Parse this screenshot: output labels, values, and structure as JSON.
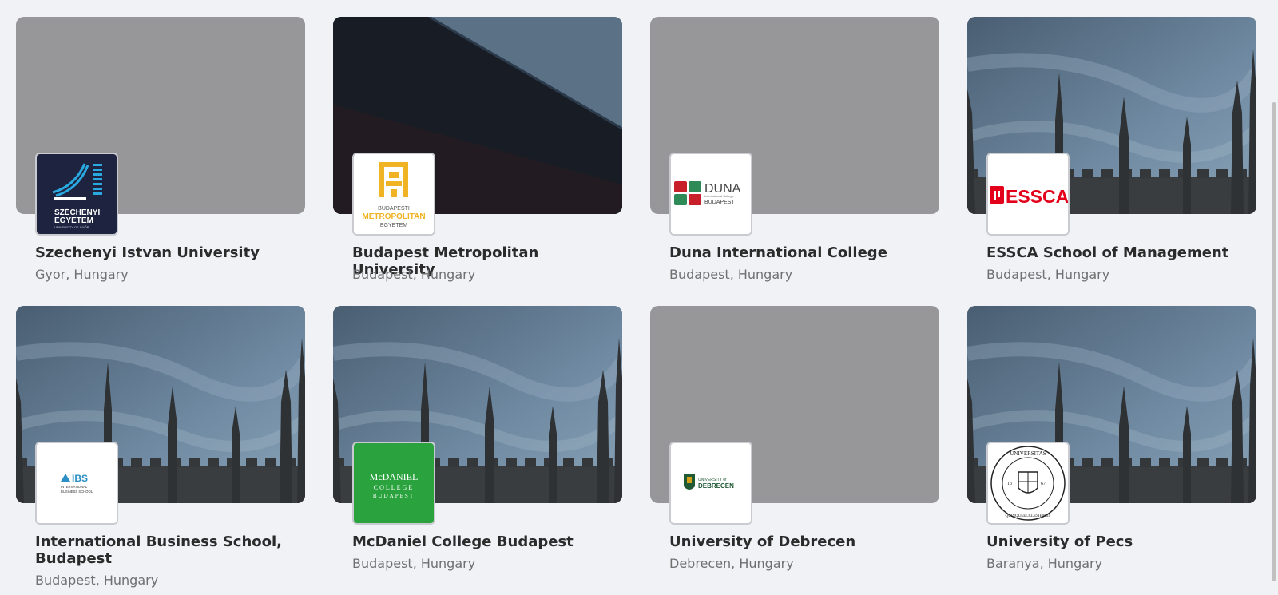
{
  "universities": [
    {
      "name": "Szechenyi Istvan University",
      "location": "Gyor, Hungary",
      "logo_text": [
        "SZÉCHENYI",
        "EGYETEM",
        "UNIVERSITY OF GYŐR"
      ]
    },
    {
      "name": "Budapest Metropolitan University",
      "location": "Budapest, Hungary",
      "logo_text": [
        "BUDAPESTI",
        "METROPOLITAN",
        "EGYETEM"
      ]
    },
    {
      "name": "Duna International College",
      "location": "Budapest, Hungary",
      "logo_text": [
        "DUNA",
        "International College",
        "BUDAPEST"
      ]
    },
    {
      "name": "ESSCA School of Management",
      "location": "Budapest, Hungary",
      "logo_text": [
        "ESSCA"
      ]
    },
    {
      "name": "International Business School, Budapest",
      "location": "Budapest, Hungary",
      "logo_text": [
        "IBS",
        "INTERNATIONAL",
        "BUSINESS SCHOOL"
      ]
    },
    {
      "name": "McDaniel College Budapest",
      "location": "Budapest, Hungary",
      "logo_text": [
        "McDANIEL",
        "COLLEGE",
        "BUDAPEST"
      ]
    },
    {
      "name": "University of Debrecen",
      "location": "Debrecen, Hungary",
      "logo_text": [
        "UNIVERSITY of",
        "DEBRECEN"
      ]
    },
    {
      "name": "University of Pecs",
      "location": "Baranya, Hungary",
      "logo_text": [
        "UNIVERSITAS",
        "QUINQUEECCLESIENSIS",
        "13",
        "67"
      ]
    }
  ],
  "colors": {
    "background": "#f0f2f6",
    "placeholder_cover": "#97979a",
    "szechenyi_navy": "#1e2440",
    "metropolitan_gold": "#f0b323",
    "duna_red": "#c8202a",
    "duna_green": "#2e8b57",
    "essca_red": "#e2001a",
    "ibs_blue": "#2a8fc4",
    "mcdaniel_green": "#2aa33e",
    "debrecen_green": "#1f5a35"
  }
}
